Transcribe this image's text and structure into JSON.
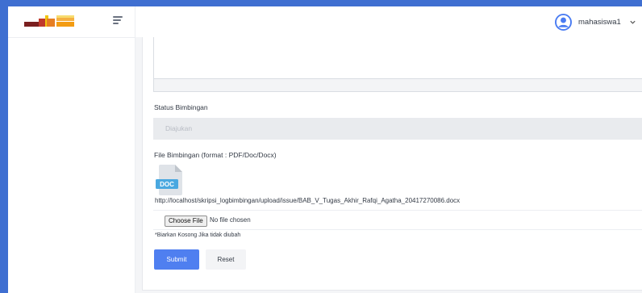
{
  "header": {
    "username": "mahasiswa1",
    "icons": [
      "app-logo",
      "menu-toggle-icon",
      "user-avatar-icon",
      "chevron-down-icon"
    ]
  },
  "form": {
    "status_label": "Status Bimbingan",
    "status_value": "Diajukan",
    "file_label": "File Bimbingan (format : PDF/Doc/Docx)",
    "file_icon_text": "DOC",
    "file_url": "http://localhost/skripsi_logbimbingan/upload/issue/BAB_V_Tugas_Akhir_Rafqi_Agatha_20417270086.docx",
    "choose_file_label": "Choose File",
    "no_file_text": "No file chosen",
    "hint": "*Biarkan Kosong Jika tidak diubah",
    "submit_label": "Submit",
    "reset_label": "Reset"
  },
  "colors": {
    "frame_border": "#3f6fd1",
    "primary": "#4f7ff0",
    "avatar": "#4a7cf2",
    "doc_icon": "#4aa8e0",
    "disabled_bg": "#e9ebee"
  }
}
